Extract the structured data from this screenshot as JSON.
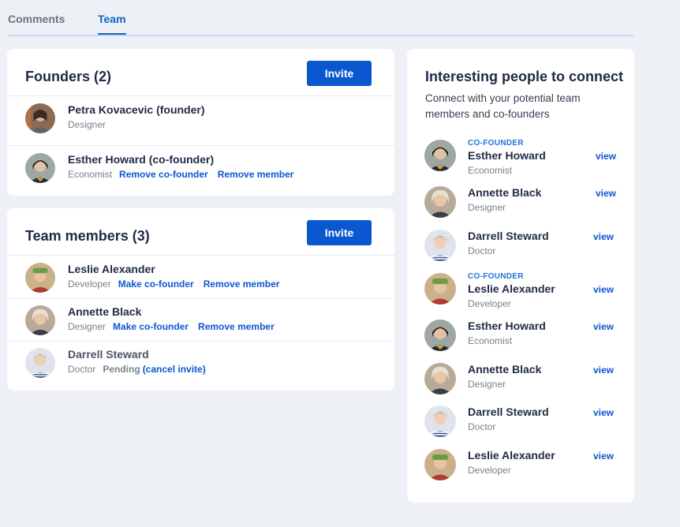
{
  "tabs": [
    {
      "label": "Comments",
      "active": false
    },
    {
      "label": "Team",
      "active": true
    }
  ],
  "accent_color": "#0b57d0",
  "founders": {
    "title": "Founders (2)",
    "invite_label": "Invite",
    "rows": [
      {
        "name": "Petra Kovacevic (founder)",
        "role": "Designer"
      },
      {
        "name": "Esther Howard (co-founder)",
        "role": "Economist",
        "action1": "Remove co-founder",
        "action2": "Remove member"
      }
    ]
  },
  "members": {
    "title": "Team members (3)",
    "invite_label": "Invite",
    "rows": [
      {
        "name": "Leslie Alexander",
        "role": "Developer",
        "action1": "Make co-founder",
        "action2": "Remove member"
      },
      {
        "name": "Annette Black",
        "role": "Designer",
        "action1": "Make co-founder",
        "action2": "Remove member"
      },
      {
        "name": "Darrell Steward",
        "role": "Doctor",
        "status": "Pending",
        "action1": "(cancel invite)"
      }
    ]
  },
  "suggestions": {
    "title": "Interesting people to connect",
    "description": "Connect with your potential team members and co-founders",
    "view_label": "view",
    "people": [
      {
        "tag": "CO-FOUNDER",
        "name": "Esther Howard",
        "role": "Economist"
      },
      {
        "tag": "",
        "name": "Annette Black",
        "role": "Designer"
      },
      {
        "tag": "",
        "name": "Darrell Steward",
        "role": "Doctor"
      },
      {
        "tag": "CO-FOUNDER",
        "name": "Leslie Alexander",
        "role": "Developer"
      },
      {
        "tag": "",
        "name": "Esther Howard",
        "role": "Economist"
      },
      {
        "tag": "",
        "name": "Annette Black",
        "role": "Designer"
      },
      {
        "tag": "",
        "name": "Darrell Steward",
        "role": "Doctor"
      },
      {
        "tag": "",
        "name": "Leslie Alexander",
        "role": "Developer"
      }
    ]
  }
}
